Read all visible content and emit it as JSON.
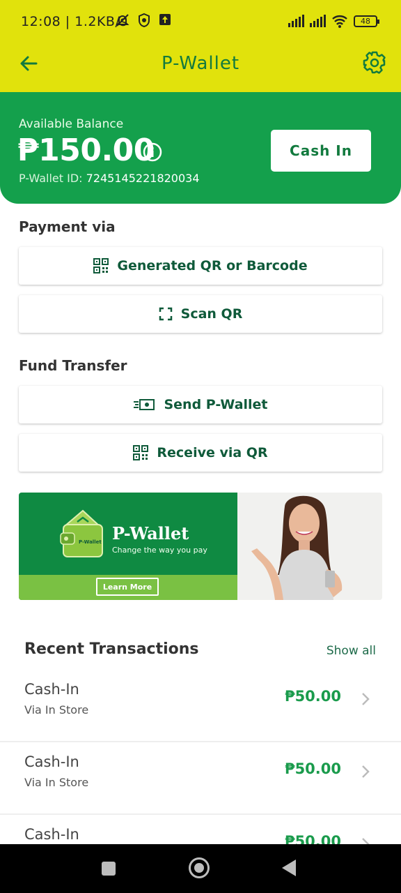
{
  "status_bar": {
    "time": "12:08 | 1.2KB/s",
    "battery": "48"
  },
  "header": {
    "title": "P-Wallet"
  },
  "balance": {
    "label": "Available Balance",
    "amount": "₱150.00",
    "wallet_id_label": "P-Wallet ID:",
    "wallet_id": "7245145221820034",
    "cash_in_label": "Cash In"
  },
  "payment": {
    "title": "Payment via",
    "generated_qr_label": "Generated QR or Barcode",
    "scan_qr_label": "Scan QR"
  },
  "fund_transfer": {
    "title": "Fund Transfer",
    "send_label": "Send P-Wallet",
    "receive_label": "Receive via QR"
  },
  "banner": {
    "brand": "P-Wallet",
    "logo_text": "P-Wallet",
    "tagline": "Change the way you pay",
    "cta": "Learn More"
  },
  "transactions": {
    "title": "Recent Transactions",
    "show_all": "Show all",
    "items": [
      {
        "name": "Cash-In",
        "via": "Via In Store",
        "amount": "₱50.00"
      },
      {
        "name": "Cash-In",
        "via": "Via In Store",
        "amount": "₱50.00"
      },
      {
        "name": "Cash-In",
        "via": "",
        "amount": "₱50.00"
      }
    ]
  },
  "colors": {
    "header_yellow": "#e1e20c",
    "balance_green": "#14a04c",
    "amount_green": "#1a9b4c",
    "dark_green_text": "#0f5a3a"
  }
}
